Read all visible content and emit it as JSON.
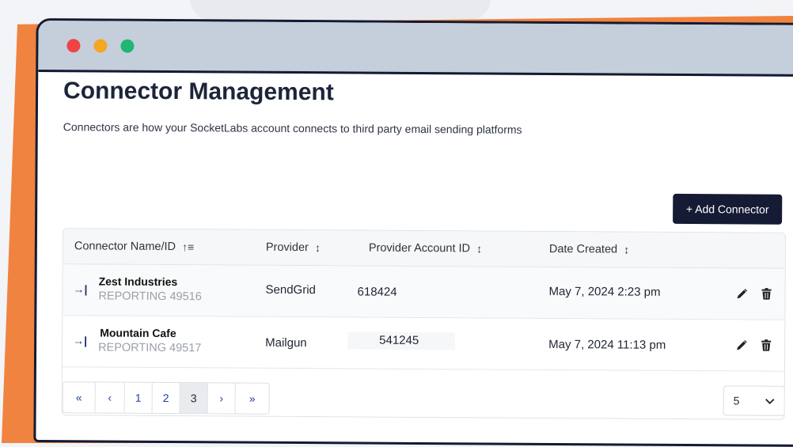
{
  "window": {
    "controls": [
      {
        "name": "close",
        "color": "#ef4444"
      },
      {
        "name": "minimize",
        "color": "#f5a623"
      },
      {
        "name": "maximize",
        "color": "#22b573"
      }
    ]
  },
  "page": {
    "title": "Connector Management",
    "subtitle": "Connectors are how your SocketLabs account connects to third party email sending platforms"
  },
  "toolbar": {
    "add_label": "+ Add Connector"
  },
  "table": {
    "headers": {
      "name": "Connector Name/ID",
      "provider": "Provider",
      "account_id": "Provider Account ID",
      "date": "Date Created"
    },
    "sort_icons": {
      "name": "↑≡",
      "other": "↕"
    },
    "rows": [
      {
        "arrow": "→|",
        "name": "Zest Industries",
        "id": "REPORTING 49516",
        "provider": "SendGrid",
        "account_id": "618424",
        "date": "May 7, 2024 2:23 pm"
      },
      {
        "arrow": "→|",
        "name": "Mountain Cafe",
        "id": "REPORTING 49517",
        "provider": "Mailgun",
        "account_id": "541245",
        "date": "May 7, 2024 11:13 pm"
      }
    ]
  },
  "pagination": {
    "first": "«",
    "prev": "‹",
    "pages": [
      "1",
      "2",
      "3"
    ],
    "current_page": "3",
    "next": "›",
    "last": "»",
    "page_size": "5",
    "dropdown_icon": "chevron-down-icon"
  }
}
